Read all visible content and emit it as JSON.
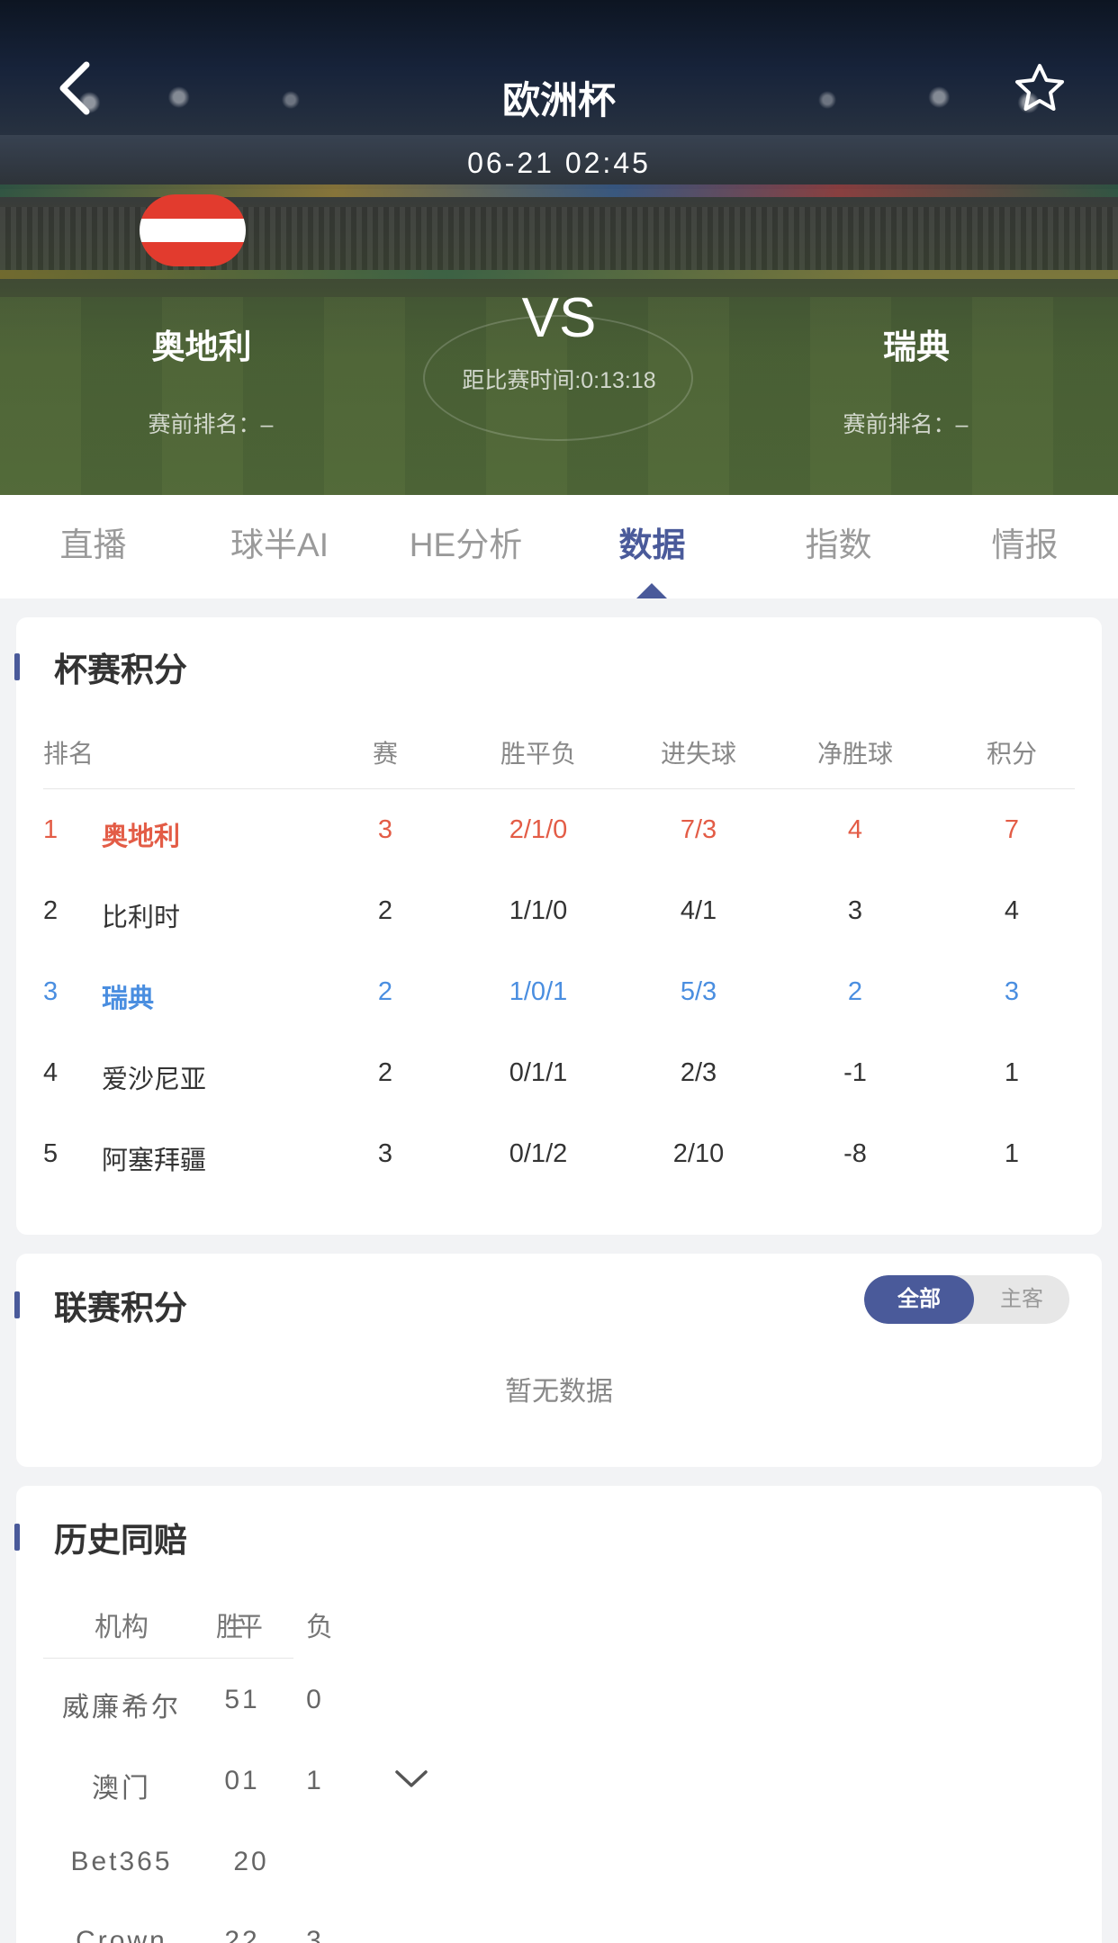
{
  "header": {
    "title": "欧洲杯",
    "datetime": "06-21 02:45",
    "home_team": "奥地利",
    "away_team": "瑞典",
    "vs": "VS",
    "countdown": "距比赛时间:0:13:18",
    "home_rank": "赛前排名：–",
    "away_rank": "赛前排名：–",
    "home_flag_colors": [
      "#e23b2e",
      "#ffffff",
      "#e23b2e"
    ]
  },
  "tabs": [
    {
      "label": "直播"
    },
    {
      "label": "球半AI"
    },
    {
      "label": "HE分析"
    },
    {
      "label": "数据"
    },
    {
      "label": "指数"
    },
    {
      "label": "情报"
    }
  ],
  "active_tab": "数据",
  "cup_standings": {
    "title": "杯赛积分",
    "columns": [
      "排名",
      "赛",
      "胜平负",
      "进失球",
      "净胜球",
      "积分"
    ],
    "rows": [
      {
        "rank": "1",
        "team": "奥地利",
        "played": "3",
        "wdl": "2/1/0",
        "goals": "7/3",
        "gd": "4",
        "pts": "7",
        "highlight": "#e35c46"
      },
      {
        "rank": "2",
        "team": "比利时",
        "played": "2",
        "wdl": "1/1/0",
        "goals": "4/1",
        "gd": "3",
        "pts": "4"
      },
      {
        "rank": "3",
        "team": "瑞典",
        "played": "2",
        "wdl": "1/0/1",
        "goals": "5/3",
        "gd": "2",
        "pts": "3",
        "highlight": "#4a8ee0"
      },
      {
        "rank": "4",
        "team": "爱沙尼亚",
        "played": "2",
        "wdl": "0/1/1",
        "goals": "2/3",
        "gd": "-1",
        "pts": "1"
      },
      {
        "rank": "5",
        "team": "阿塞拜疆",
        "played": "3",
        "wdl": "0/1/2",
        "goals": "2/10",
        "gd": "-8",
        "pts": "1"
      }
    ]
  },
  "league_standings": {
    "title": "联赛积分",
    "toggle": [
      "全部",
      "主客"
    ],
    "empty_text": "暂无数据"
  },
  "history": {
    "title": "历史同赔",
    "columns": [
      "机构",
      "胜",
      "平",
      "负"
    ],
    "rows": [
      {
        "org": "威廉希尔",
        "a": "51",
        "b": "0"
      },
      {
        "org": "澳门",
        "a": "01",
        "b": "1"
      },
      {
        "org": "Bet365",
        "a": "20",
        "b": ""
      },
      {
        "org": "Crown",
        "a": "22",
        "b": "3"
      }
    ]
  },
  "colors": {
    "accent": "#4a5a9a",
    "home_highlight": "#e35c46",
    "away_highlight": "#4a8ee0"
  }
}
